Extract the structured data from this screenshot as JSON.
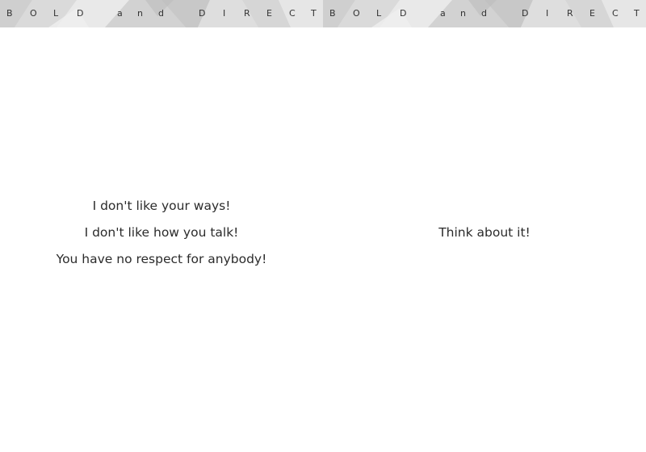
{
  "banner": {
    "left": {
      "letters": [
        "B",
        "O",
        "L",
        "D",
        "a",
        "n",
        "d",
        "D",
        "I",
        "R",
        "E",
        "C",
        "T"
      ]
    },
    "right": {
      "letters": [
        "B",
        "O",
        "L",
        "D",
        "a",
        "n",
        "d",
        "D",
        "I",
        "R",
        "E",
        "C",
        "T"
      ]
    }
  },
  "left_panel": {
    "lines": [
      "I don't like your ways!",
      "I don't like how you talk!",
      "You have no respect for anybody!"
    ]
  },
  "right_panel": {
    "lines": [
      "Think about it!"
    ]
  }
}
